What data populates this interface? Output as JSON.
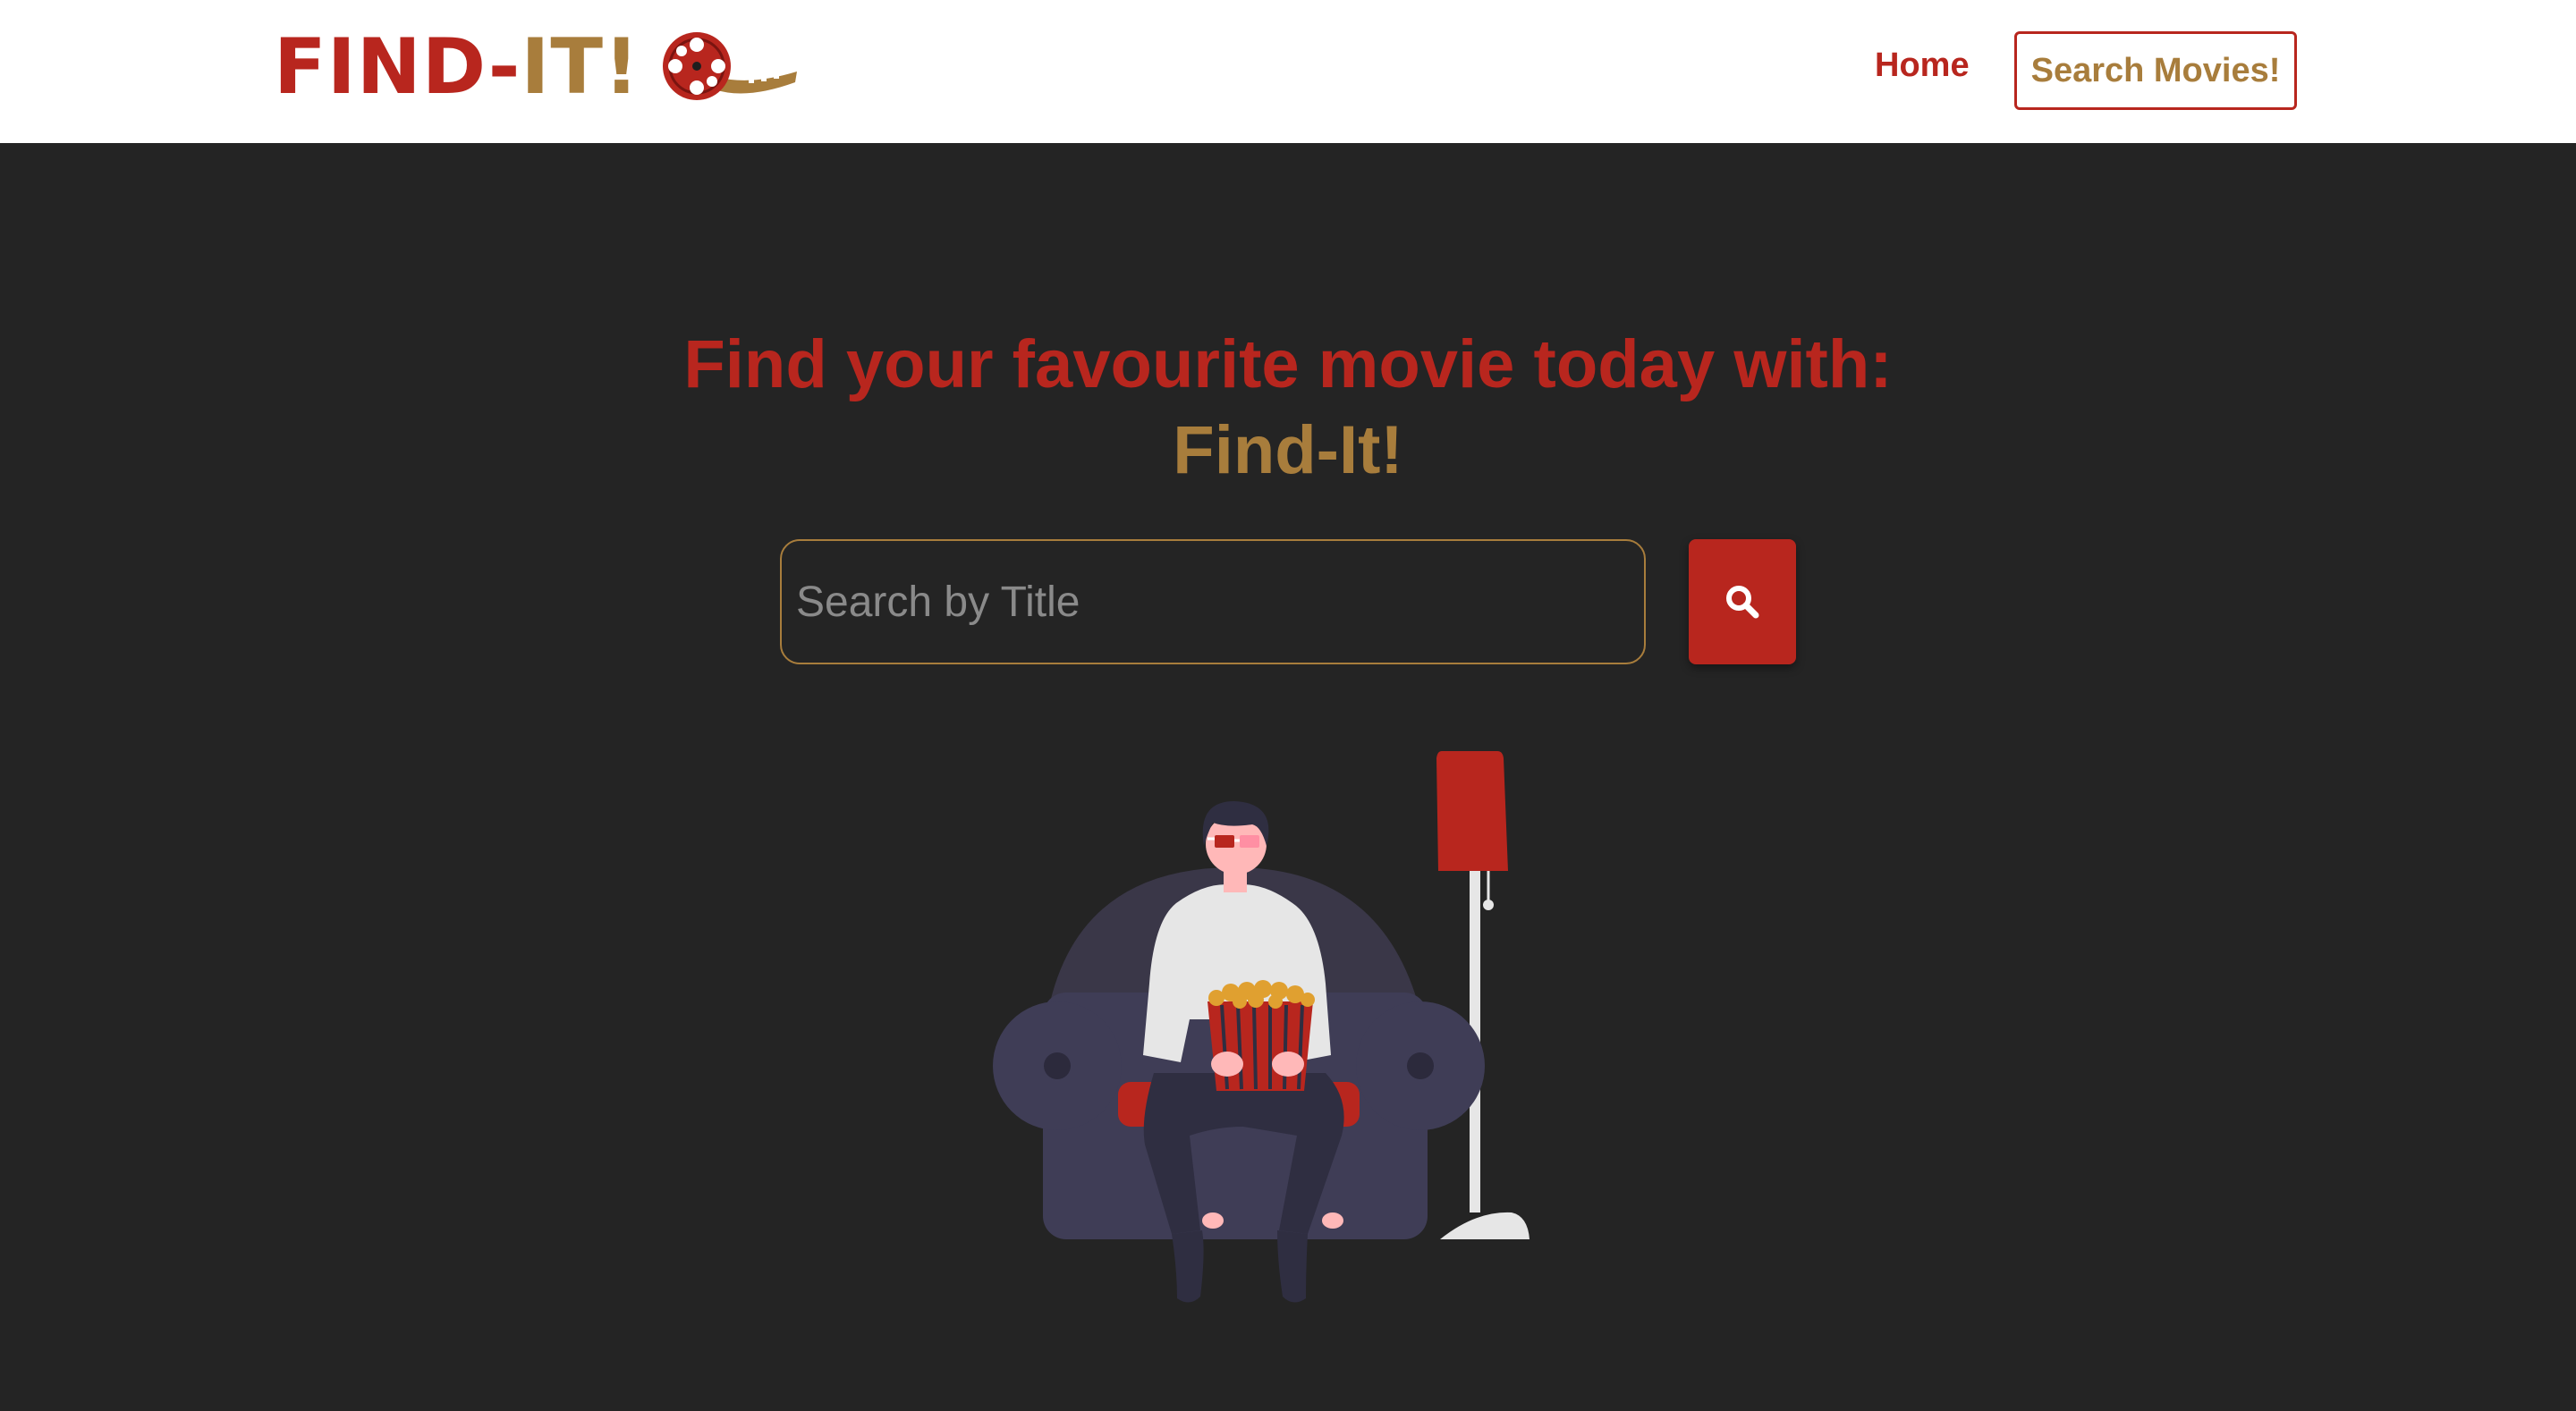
{
  "navbar": {
    "logo": {
      "part1": "FIND-",
      "part2": "IT!",
      "icon": "film-reel-icon"
    },
    "links": {
      "home": "Home",
      "search_movies": "Search Movies!"
    }
  },
  "hero": {
    "title_line1": "Find your favourite movie today with:",
    "title_line2": "Find-It!"
  },
  "search": {
    "placeholder": "Search by Title",
    "value": "",
    "button_icon": "search-icon"
  },
  "illustration": {
    "subject": "person-watching-movie-illustration"
  },
  "colors": {
    "background": "#242424",
    "navbar": "#ffffff",
    "red": "#b8261e",
    "gold": "#a87d3c"
  }
}
